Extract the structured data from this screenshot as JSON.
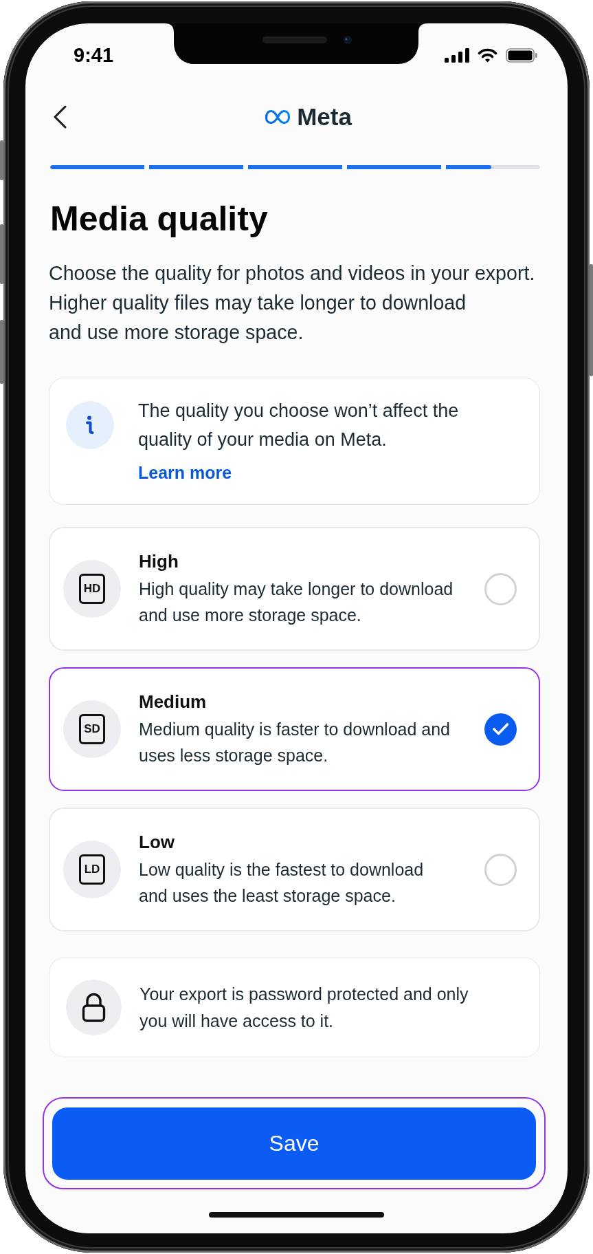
{
  "status_bar": {
    "time": "9:41"
  },
  "header": {
    "logo_text": "Meta"
  },
  "progress": {
    "level": 0.9
  },
  "title": "Media quality",
  "description": [
    "Choose the quality for photos and videos in your export.",
    "Higher quality files may take longer to download and use more storage space."
  ],
  "info_card": {
    "text": "The quality you choose won’t affect the quality of your media on Meta.",
    "link": "Learn more"
  },
  "options": [
    {
      "tag": "HD",
      "label": "High",
      "description": "High quality may take longer to download and use more storage space.",
      "selected": false
    },
    {
      "tag": "SD",
      "label": "Medium",
      "description": "Medium quality is faster to download and uses less storage space.",
      "selected": true
    },
    {
      "tag": "LD",
      "label": "Low",
      "description": "Low quality is the fastest to download and uses the least storage space.",
      "selected": false
    }
  ],
  "security_note": {
    "text": "Your export is password protected and only you will have access to it."
  },
  "save_button": {
    "label": "Save",
    "focused": true
  }
}
